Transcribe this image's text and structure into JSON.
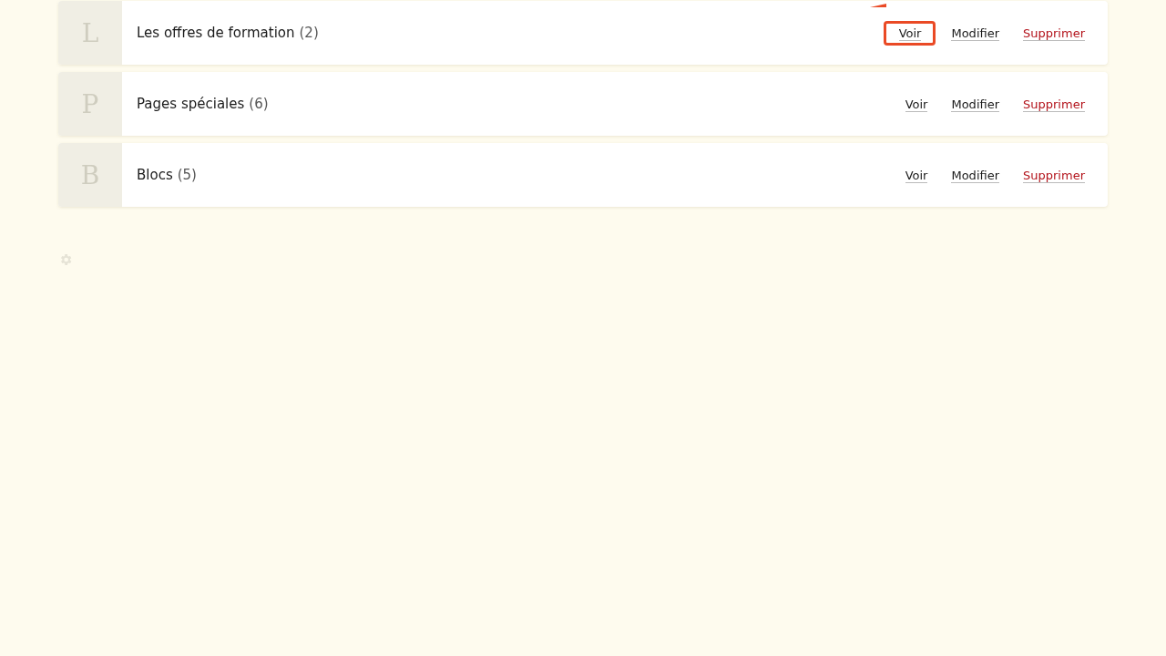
{
  "sections": [
    {
      "initial": "L",
      "title": "Les offres de formation",
      "count": "(2)",
      "actions": [
        {
          "label": "Voir",
          "kind": "view",
          "highlighted": true
        },
        {
          "label": "Modifier",
          "kind": "edit",
          "highlighted": false
        },
        {
          "label": "Supprimer",
          "kind": "delete",
          "highlighted": false
        }
      ]
    },
    {
      "initial": "P",
      "title": "Pages spéciales",
      "count": "(6)",
      "actions": [
        {
          "label": "Voir",
          "kind": "view",
          "highlighted": false
        },
        {
          "label": "Modifier",
          "kind": "edit",
          "highlighted": false
        },
        {
          "label": "Supprimer",
          "kind": "delete",
          "highlighted": false
        }
      ]
    },
    {
      "initial": "B",
      "title": "Blocs",
      "count": "(5)",
      "actions": [
        {
          "label": "Voir",
          "kind": "view",
          "highlighted": false
        },
        {
          "label": "Modifier",
          "kind": "edit",
          "highlighted": false
        },
        {
          "label": "Supprimer",
          "kind": "delete",
          "highlighted": false
        }
      ]
    }
  ]
}
